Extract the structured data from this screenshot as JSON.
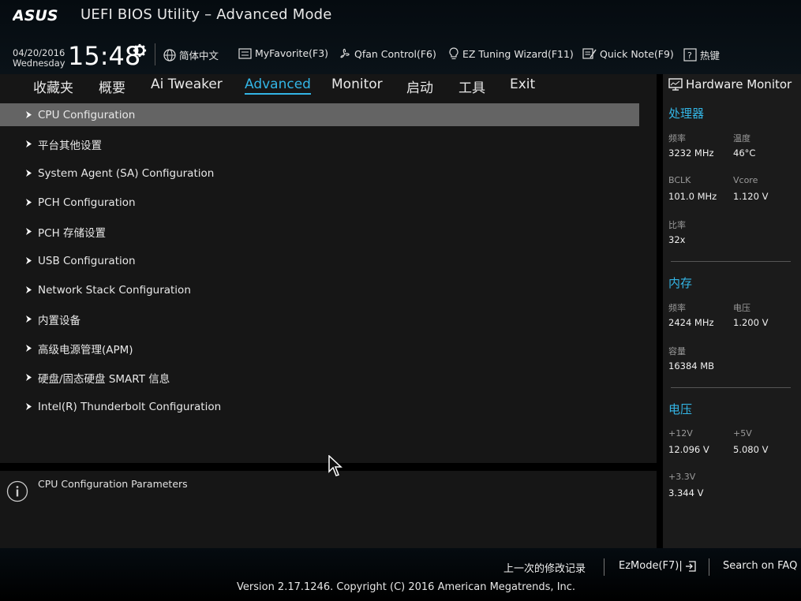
{
  "app": {
    "brand": "ASUS",
    "title": "UEFI BIOS Utility – Advanced Mode"
  },
  "status": {
    "date": "04/20/2016",
    "day": "Wednesday",
    "time": "15:48"
  },
  "toolbar": {
    "language": "简体中文",
    "favorite": "MyFavorite(F3)",
    "qfan": "Qfan Control(F6)",
    "ez_tuning": "EZ Tuning Wizard(F11)",
    "quick_note": "Quick Note(F9)",
    "hotkeys": "热键"
  },
  "tabs": [
    {
      "label": "收藏夹"
    },
    {
      "label": "概要"
    },
    {
      "label": "Ai Tweaker"
    },
    {
      "label": "Advanced"
    },
    {
      "label": "Monitor"
    },
    {
      "label": "启动"
    },
    {
      "label": "工具"
    },
    {
      "label": "Exit"
    }
  ],
  "active_tab": "Advanced",
  "menu": [
    {
      "label": "CPU Configuration"
    },
    {
      "label": "平台其他设置"
    },
    {
      "label": "System Agent (SA) Configuration"
    },
    {
      "label": "PCH Configuration"
    },
    {
      "label": "PCH 存储设置"
    },
    {
      "label": "USB Configuration"
    },
    {
      "label": "Network Stack Configuration"
    },
    {
      "label": "内置设备"
    },
    {
      "label": "高级电源管理(APM)"
    },
    {
      "label": "硬盘/固态硬盘 SMART 信息"
    },
    {
      "label": "Intel(R) Thunderbolt Configuration"
    }
  ],
  "selected_menu": "CPU Configuration",
  "help": {
    "text": "CPU Configuration Parameters"
  },
  "hw_monitor": {
    "title": "Hardware Monitor",
    "cpu": {
      "heading": "处理器",
      "freq_label": "频率",
      "freq": "3232 MHz",
      "temp_label": "温度",
      "temp": "46°C",
      "bclk_label": "BCLK",
      "bclk": "101.0 MHz",
      "vcore_label": "Vcore",
      "vcore": "1.120 V",
      "ratio_label": "比率",
      "ratio": "32x"
    },
    "memory": {
      "heading": "内存",
      "freq_label": "频率",
      "freq": "2424 MHz",
      "volt_label": "电压",
      "volt": "1.200 V",
      "cap_label": "容量",
      "cap": "16384 MB"
    },
    "voltage": {
      "heading": "电压",
      "v12_label": "+12V",
      "v12": "12.096 V",
      "v5_label": "+5V",
      "v5": "5.080 V",
      "v33_label": "+3.3V",
      "v33": "3.344 V"
    }
  },
  "footer": {
    "last_changes": "上一次的修改记录",
    "ezmode": "EzMode(F7)|",
    "search": "Search on FAQ",
    "copyright": "Version 2.17.1246. Copyright (C) 2016 American Megatrends, Inc."
  },
  "colors": {
    "accent": "#33b5e5",
    "selected": "#646464",
    "panel": "#161616"
  }
}
